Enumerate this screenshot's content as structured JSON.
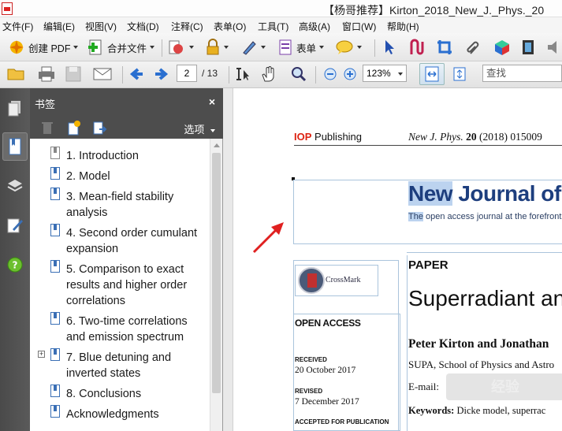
{
  "window": {
    "title": "【杨哥推荐】Kirton_2018_New_J._Phys._20"
  },
  "menu": [
    "文件(F)",
    "编辑(E)",
    "视图(V)",
    "文档(D)",
    "注释(C)",
    "表单(O)",
    "工具(T)",
    "高级(A)",
    "窗口(W)",
    "帮助(H)"
  ],
  "toolbar1": {
    "create_pdf": "创建 PDF",
    "merge_files": "合并文件",
    "forms": "表单"
  },
  "toolbar2": {
    "page_current": "2",
    "page_total": "/ 13",
    "zoom": "123%",
    "search_placeholder": "查找"
  },
  "bookmarks_panel": {
    "title": "书签",
    "close": "×",
    "options": "选项",
    "items": [
      {
        "label": "1. Introduction",
        "icon": "bookmark-grey-icon"
      },
      {
        "label": "2. Model",
        "icon": "bookmark-icon"
      },
      {
        "label": "3. Mean-field stability analysis",
        "icon": "bookmark-icon"
      },
      {
        "label": "4. Second order cumulant expansion",
        "icon": "bookmark-icon"
      },
      {
        "label": "5. Comparison to exact results and higher order correlations",
        "icon": "bookmark-icon"
      },
      {
        "label": "6. Two-time correlations and emission spectrum",
        "icon": "bookmark-icon"
      },
      {
        "label": "7. Blue detuning and inverted states",
        "icon": "bookmark-icon",
        "expandable": true
      },
      {
        "label": "8. Conclusions",
        "icon": "bookmark-icon"
      },
      {
        "label": "Acknowledgments",
        "icon": "bookmark-icon"
      }
    ]
  },
  "document": {
    "publisher": "Publishing",
    "publisher_prefix": "IOP",
    "journal_ref_italic": "New J. Phys.",
    "journal_volume": "20",
    "journal_ref_rest": "(2018) 015009",
    "journal_title_sel": "New",
    "journal_title_rest": " Journal of",
    "journal_sub_sel": "The",
    "journal_sub_rest": " open access journal at the forefront",
    "crossmark": "CrossMark",
    "open_access": "OPEN ACCESS",
    "received_lbl": "RECEIVED",
    "received_val": "20 October 2017",
    "revised_lbl": "REVISED",
    "revised_val": "7 December 2017",
    "accepted_lbl": "ACCEPTED FOR PUBLICATION",
    "paper_lbl": "PAPER",
    "paper_title": "Superradiant an",
    "authors": "Peter Kirton and Jonathan",
    "affiliation": "SUPA, School of Physics and Astro",
    "email": "E-mail:",
    "keywords_lbl": "Keywords:",
    "keywords_val": " Dicke model, superrac"
  },
  "watermark": "经验",
  "colors": {
    "journal_blue": "#1d3e7e",
    "selection": "#bcd3ef",
    "arrow_red": "#e02020",
    "panel_dark": "#4d4d4d"
  }
}
